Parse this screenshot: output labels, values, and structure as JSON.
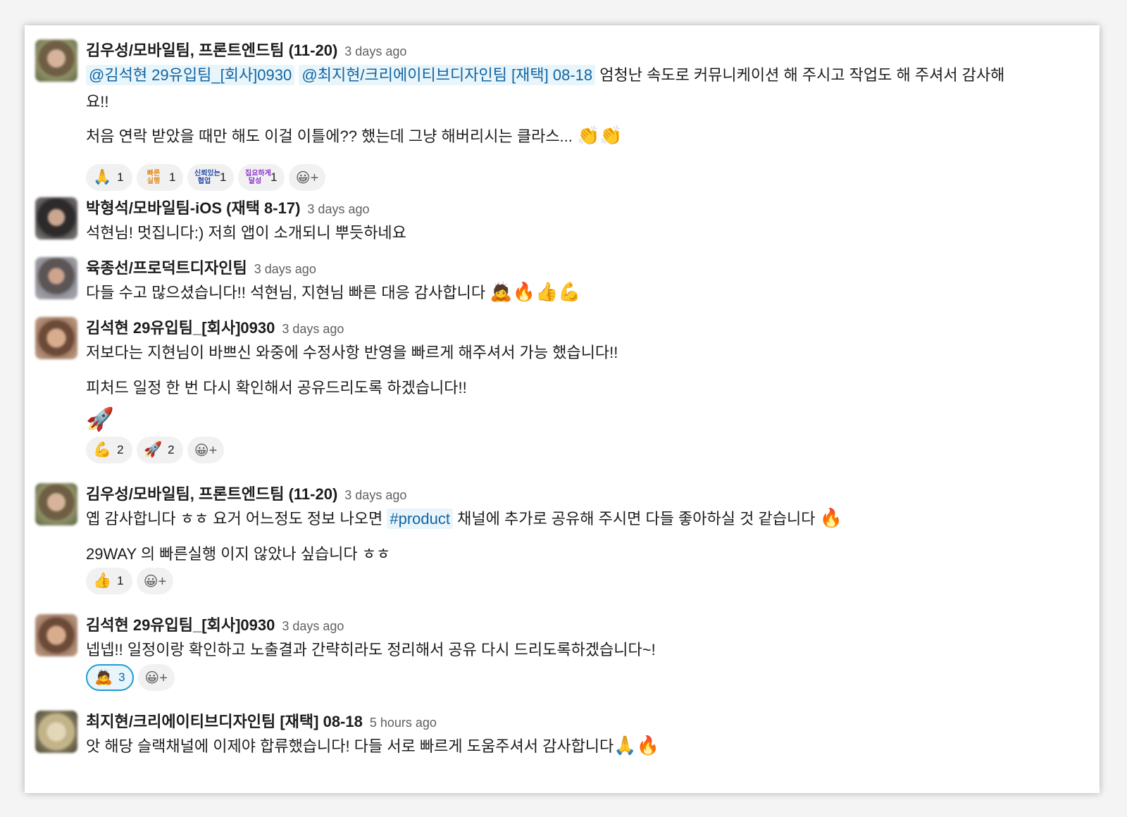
{
  "messages": [
    {
      "author": "김우성/모바일팀, 프론트엔드팀 (11-20)",
      "time": "3 days ago",
      "mention1": "@김석현 29유입팀_[회사]0930",
      "mention2": "@최지현/크리에이티브디자인팀 [재택] 08-18",
      "line1_text": "엄청난 속도로 커뮤니케이션 해 주시고 작업도 해 주셔서 감사해",
      "line1_cont": "요!!",
      "line2": "처음 연락 받았을 때만 해도 이걸 이틀에?? 했는데 그냥 해버리시는 클라스...",
      "line2_emoji": "👏👏",
      "reactions": [
        {
          "emoji": "🙏",
          "count": "1"
        },
        {
          "badge": "빠른\n실행",
          "count": "1"
        },
        {
          "badge": "신뢰있는\n협업",
          "count": "1"
        },
        {
          "badge": "집요하게\n달성",
          "count": "1"
        }
      ]
    },
    {
      "author": "박형석/모바일팀-iOS (재택 8-17)",
      "time": "3 days ago",
      "line1": "석현님! 멋집니다:) 저희 앱이 소개되니 뿌듯하네요"
    },
    {
      "author": "육종선/프로덕트디자인팀",
      "time": "3 days ago",
      "line1": "다들 수고 많으셨습니다!! 석현님, 지현님 빠른 대응 감사합니다",
      "emoji": "🙇🔥👍💪"
    },
    {
      "author": "김석현 29유입팀_[회사]0930",
      "time": "3 days ago",
      "line1": "저보다는 지현님이 바쁘신 와중에 수정사항 반영을 빠르게 해주셔서 가능 했습니다!!",
      "line2": "피처드 일정 한 번 다시 확인해서 공유드리도록 하겠습니다!!",
      "line3": "🚀",
      "reactions": [
        {
          "emoji": "💪",
          "count": "2"
        },
        {
          "emoji": "🚀",
          "count": "2"
        }
      ]
    },
    {
      "author": "김우성/모바일팀, 프론트엔드팀 (11-20)",
      "time": "3 days ago",
      "line1_pre": "옙 감사합니다 ㅎㅎ 요거 어느정도 정보 나오면",
      "channel": "#product",
      "line1_post": "채널에 추가로 공유해 주시면 다들 좋아하실 것 같습니다",
      "line1_emoji": "🔥",
      "line2": "29WAY 의 빠른실행 이지 않았나 싶습니다 ㅎㅎ",
      "reactions": [
        {
          "emoji": "👍",
          "count": "1"
        }
      ]
    },
    {
      "author": "김석현 29유입팀_[회사]0930",
      "time": "3 days ago",
      "line1": "넵넵!! 일정이랑 확인하고 노출결과 간략히라도 정리해서 공유 다시 드리도록하겠습니다~!",
      "reactions": [
        {
          "emoji": "🙇",
          "count": "3"
        }
      ]
    },
    {
      "author": "최지현/크리에이티브디자인팀 [재택] 08-18",
      "time": "5 hours ago",
      "line1": "앗 해당 슬랙채널에 이제야 합류했습니다! 다들 서로 빠르게 도움주셔서 감사합니다",
      "emoji": "🙏🔥"
    }
  ],
  "add_reaction_icon": "😀+"
}
